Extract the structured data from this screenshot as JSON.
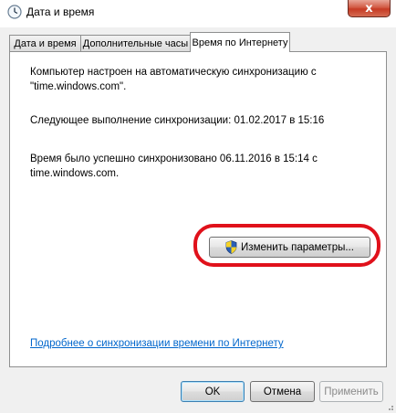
{
  "window": {
    "title": "Дата и время",
    "close_glyph": "x"
  },
  "tabs": [
    {
      "label": "Дата и время",
      "active": false
    },
    {
      "label": "Дополнительные часы",
      "active": false
    },
    {
      "label": "Время по Интернету",
      "active": true
    }
  ],
  "panel": {
    "para1_line1": "Компьютер настроен на автоматическую синхронизацию с",
    "para1_line2": "\"time.windows.com\".",
    "para2": "Следующее выполнение синхронизации: 01.02.2017 в 15:16",
    "para3_line1": "Время было успешно синхронизовано 06.11.2016 в 15:14 с",
    "para3_line2": "time.windows.com.",
    "change_button_label": "Изменить параметры...",
    "link_text": "Подробнее о синхронизации времени по Интернету"
  },
  "buttons": {
    "ok": "OK",
    "cancel": "Отмена",
    "apply": "Применить"
  },
  "colors": {
    "highlight": "#e0111b",
    "link": "#0066cc"
  },
  "icons": {
    "title": "clock-icon",
    "shield": "uac-shield-icon"
  }
}
